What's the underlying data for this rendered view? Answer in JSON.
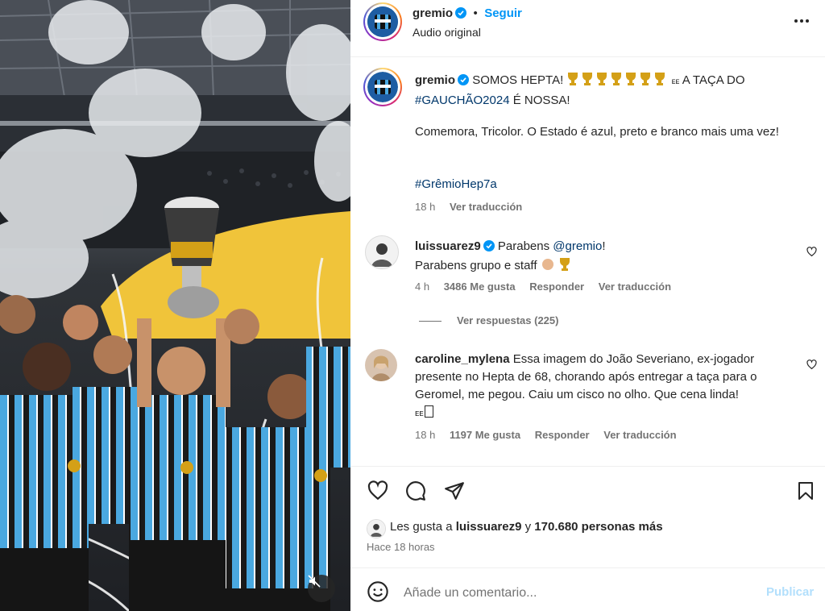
{
  "post": {
    "author": "gremio",
    "follow_label": "Seguir",
    "subtitle": "Audio original",
    "more_label": "•••"
  },
  "caption": {
    "author": "gremio",
    "line1_text": "SOMOS HEPTA!",
    "line1_after": "A TAÇA DO",
    "hashtag_year": "#GAUCHÃO2024",
    "line2_after": "É NOSSA!",
    "paragraph": "Comemora, Tricolor. O Estado é azul, preto e branco mais uma vez!",
    "hashtag": "#GrêmioHep7a",
    "time": "18 h",
    "translate": "Ver traducción"
  },
  "comments": [
    {
      "author": "luissuarez9",
      "mention": "@gremio",
      "text_before": "Parabens",
      "text_after": "!",
      "line2": "Parabens grupo e staff",
      "time": "4 h",
      "likes": "3486 Me gusta",
      "reply": "Responder",
      "translate": "Ver traducción",
      "replies": "Ver respuestas (225)"
    },
    {
      "author": "caroline_mylena",
      "text": "Essa imagem do João Severiano, ex-jogador presente no Hepta de 68, chorando após entregar a taça para o Geromel, me pegou. Caiu um cisco no olho. Que cena linda!",
      "text_tail": "ᴇᴇ",
      "time": "18 h",
      "likes": "1197 Me gusta",
      "reply": "Responder",
      "translate": "Ver traducción"
    }
  ],
  "likes": {
    "prefix": "Les gusta a",
    "user": "luissuarez9",
    "connector": "y",
    "others": "170.680 personas más",
    "time": "Hace 18 horas"
  },
  "composer": {
    "placeholder": "Añade un comentario...",
    "publish": "Publicar"
  },
  "colors": {
    "accent": "#0095f6",
    "verified": "#0095f6",
    "jersey_blue": "#4aa8e0",
    "trophy_gold": "#d4a017"
  }
}
